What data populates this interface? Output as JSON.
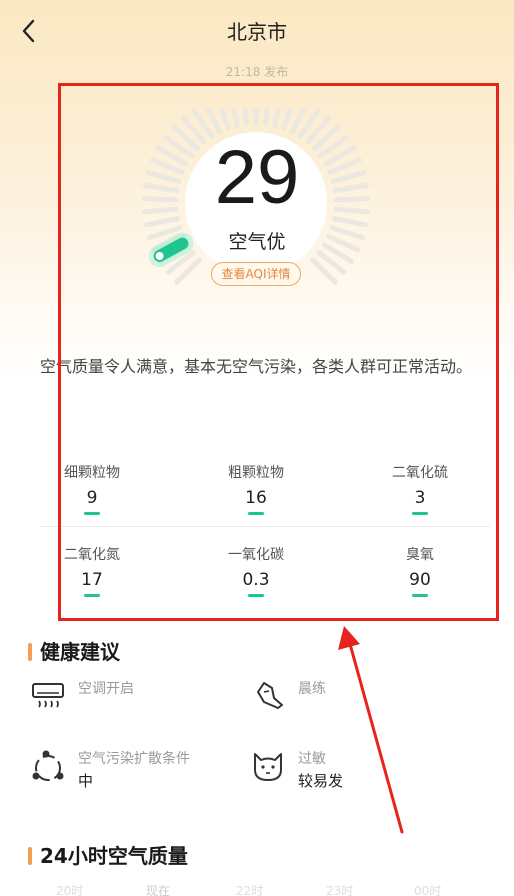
{
  "header": {
    "city": "北京市",
    "publish_time": "21:18 发布"
  },
  "aqi": {
    "value": "29",
    "level": "空气优",
    "detail_label": "查看AQI详情",
    "gauge_fraction": 0.06
  },
  "advice": "空气质量令人满意，基本无空气污染，各类人群可正常活动。",
  "pollutants": [
    {
      "name": "细颗粒物",
      "value": "9"
    },
    {
      "name": "粗颗粒物",
      "value": "16"
    },
    {
      "name": "二氧化硫",
      "value": "3"
    },
    {
      "name": "二氧化氮",
      "value": "17"
    },
    {
      "name": "一氧化碳",
      "value": "0.3"
    },
    {
      "name": "臭氧",
      "value": "90"
    }
  ],
  "health": {
    "title": "健康建议",
    "tips": [
      {
        "label": "空调开启",
        "value": "",
        "icon": "air-conditioner-icon"
      },
      {
        "label": "晨练",
        "value": "",
        "icon": "running-shoe-icon"
      },
      {
        "label": "空气污染扩散条件",
        "value": "中",
        "icon": "diffusion-icon"
      },
      {
        "label": "过敏",
        "value": "较易发",
        "icon": "allergy-cat-icon"
      }
    ]
  },
  "hourly": {
    "title": "24小时空气质量",
    "labels": [
      "20时",
      "现在",
      "22时",
      "23时",
      "00时"
    ]
  },
  "colors": {
    "accent": "#f0a050",
    "good": "#1fc58e",
    "highlight": "#e8231c"
  }
}
